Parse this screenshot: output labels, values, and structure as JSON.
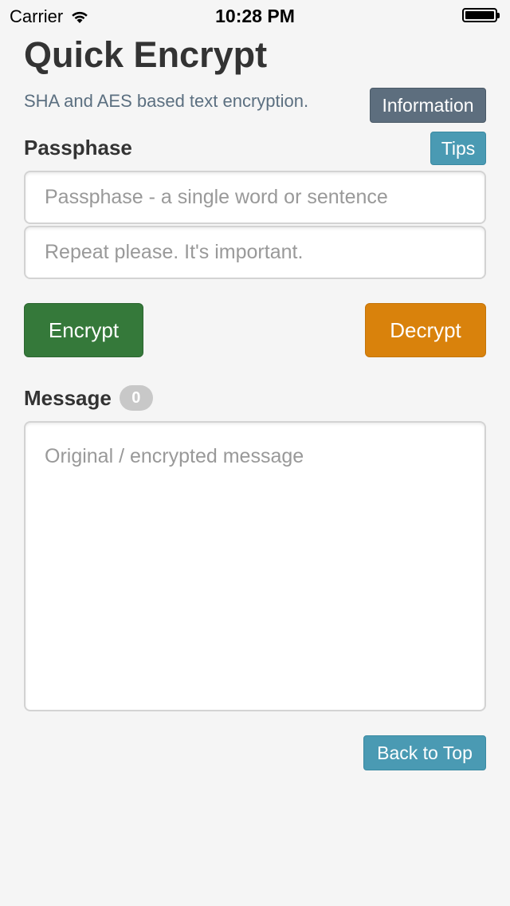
{
  "status_bar": {
    "carrier": "Carrier",
    "time": "10:28 PM",
    "wifi_icon": "wifi-icon",
    "battery_icon": "battery-icon",
    "battery_level": 1.0
  },
  "header": {
    "title": "Quick Encrypt",
    "subtitle": "SHA and AES based text encryption.",
    "info_label": "Information"
  },
  "passphrase": {
    "label": "Passphase",
    "tips_label": "Tips",
    "input1_placeholder": "Passphase - a single word or sentence",
    "input1_value": "",
    "input2_placeholder": "Repeat please. It's important.",
    "input2_value": ""
  },
  "actions": {
    "encrypt_label": "Encrypt",
    "decrypt_label": "Decrypt"
  },
  "message": {
    "label": "Message",
    "count": "0",
    "placeholder": "Original / encrypted message",
    "value": ""
  },
  "footer": {
    "back_to_top_label": "Back to Top"
  },
  "colors": {
    "background": "#f5f5f5",
    "info_button": "#5d6e7e",
    "tips_button": "#4a9ab3",
    "encrypt_button": "#35793a",
    "decrypt_button": "#d9820c",
    "subtitle_text": "#5b6f80"
  }
}
